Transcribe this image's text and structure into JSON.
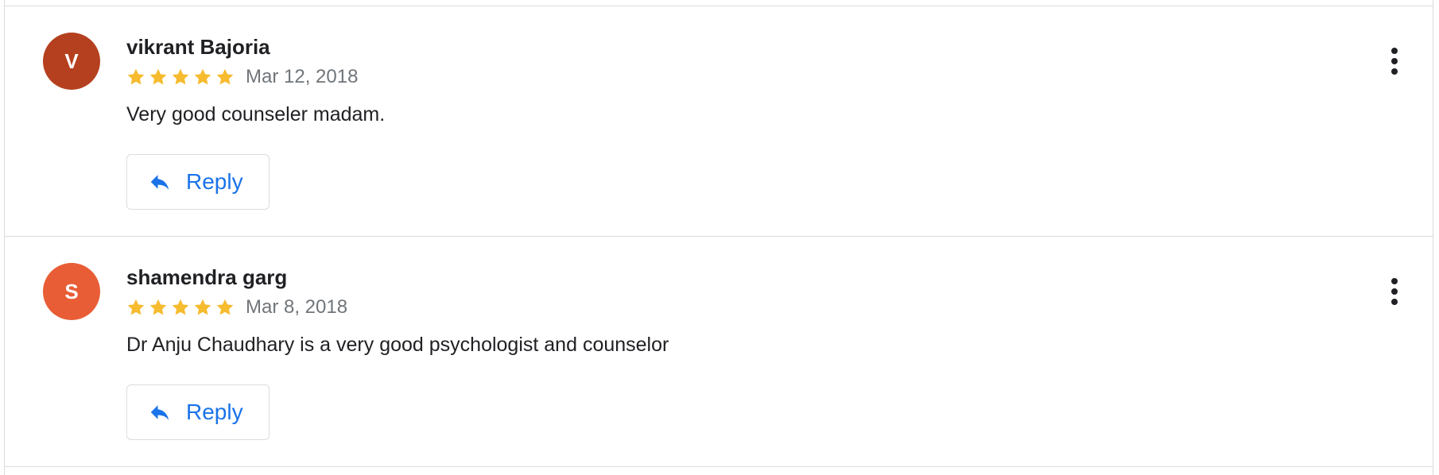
{
  "reviews": [
    {
      "author": "vikrant Bajoria",
      "initial": "V",
      "avatar_color": "#b5401f",
      "rating": 5,
      "date": "Mar 12, 2018",
      "text": "Very good counseler madam.",
      "reply_label": "Reply"
    },
    {
      "author": "shamendra garg",
      "initial": "S",
      "avatar_color": "#e85d35",
      "rating": 5,
      "date": "Mar 8, 2018",
      "text": "Dr Anju Chaudhary is a very good psychologist and counselor",
      "reply_label": "Reply"
    }
  ],
  "colors": {
    "star": "#f6bb2e",
    "link": "#1a73e8",
    "divider": "#dadce0"
  },
  "icons": {
    "star": "star-icon",
    "reply": "reply-arrow-icon",
    "more": "more-vertical-icon"
  }
}
